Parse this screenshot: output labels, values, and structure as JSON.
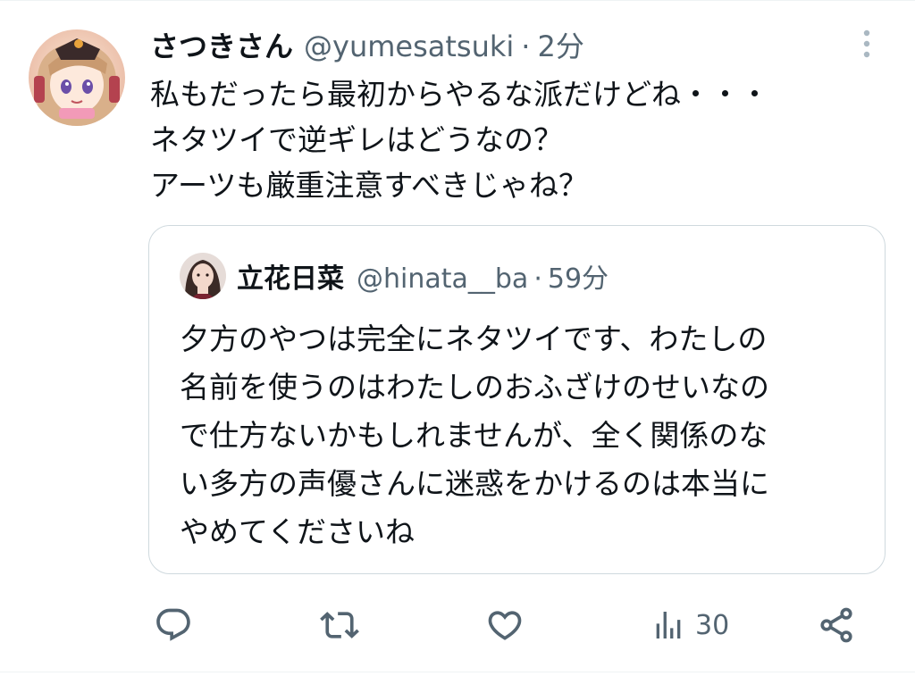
{
  "tweet": {
    "display_name": "さつきさん",
    "handle": "@yumesatsuki",
    "separator": "·",
    "time": "2分",
    "text_lines": [
      "私もだったら最初からやるな派だけどね・・・",
      "ネタツイで逆ギレはどうなの？",
      "アーツも厳重注意すべきじゃね？"
    ]
  },
  "quote": {
    "display_name": "立花日菜",
    "handle": "@hinata__ba",
    "separator": "·",
    "time": "59分",
    "text_lines": [
      "夕方のやつは完全にネタツイです、わたしの",
      "名前を使うのはわたしのおふざけのせいなの",
      "で仕方ないかもしれませんが、全く関係のな",
      "い多方の声優さんに迷惑をかけるのは本当に",
      "やめてくださいね"
    ]
  },
  "actions": {
    "reply_icon": "reply-icon",
    "retweet_icon": "retweet-icon",
    "like_icon": "heart-icon",
    "views_icon": "views-icon",
    "views_count": "30",
    "share_icon": "share-icon"
  },
  "colors": {
    "text_primary": "#0f1419",
    "text_secondary": "#536471",
    "border": "#cfd9de"
  }
}
